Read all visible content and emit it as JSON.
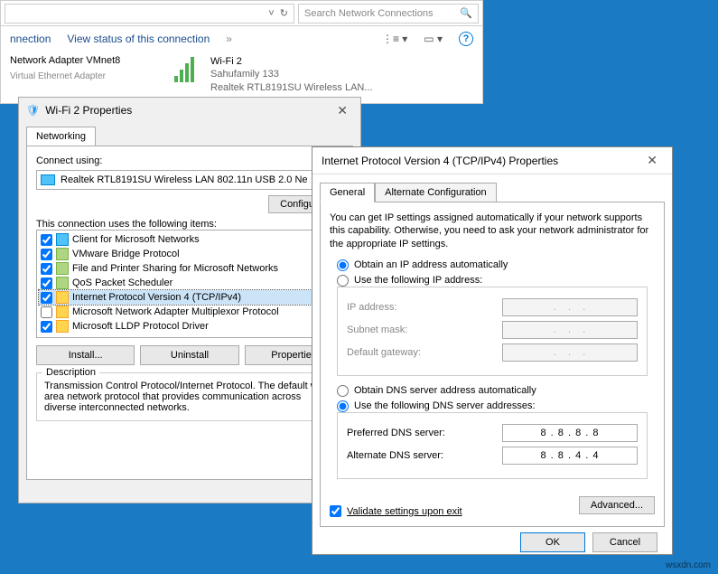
{
  "explorer": {
    "search_placeholder": "Search Network Connections",
    "menu_connection": "nnection",
    "menu_viewstatus": "View status of this connection",
    "sidebar_adapter": "Network Adapter VMnet8",
    "sidebar_virtual": "Virtual Ethernet Adapter",
    "wifi_name": "Wi-Fi 2",
    "wifi_ssid": "Sahufamily  133",
    "wifi_device": "Realtek RTL8191SU Wireless LAN..."
  },
  "props": {
    "title": "Wi-Fi 2 Properties",
    "tab_networking": "Networking",
    "connect_using": "Connect using:",
    "adapter": "Realtek RTL8191SU Wireless LAN 802.11n USB 2.0 Ne",
    "configure_btn": "Configure...",
    "items_label": "This connection uses the following items:",
    "items": [
      {
        "checked": true,
        "label": "Client for Microsoft Networks",
        "icon": "blue"
      },
      {
        "checked": true,
        "label": "VMware Bridge Protocol",
        "icon": "green"
      },
      {
        "checked": true,
        "label": "File and Printer Sharing for Microsoft Networks",
        "icon": "green"
      },
      {
        "checked": true,
        "label": "QoS Packet Scheduler",
        "icon": "green"
      },
      {
        "checked": true,
        "label": "Internet Protocol Version 4 (TCP/IPv4)",
        "icon": "yellow",
        "selected": true
      },
      {
        "checked": false,
        "label": "Microsoft Network Adapter Multiplexor Protocol",
        "icon": "yellow"
      },
      {
        "checked": true,
        "label": "Microsoft LLDP Protocol Driver",
        "icon": "yellow"
      }
    ],
    "install_btn": "Install...",
    "uninstall_btn": "Uninstall",
    "properties_btn": "Properties",
    "desc_label": "Description",
    "desc_text": "Transmission Control Protocol/Internet Protocol. The default wide area network protocol that provides communication across diverse interconnected networks."
  },
  "ipv4": {
    "title": "Internet Protocol Version 4 (TCP/IPv4) Properties",
    "tab_general": "General",
    "tab_alt": "Alternate Configuration",
    "info": "You can get IP settings assigned automatically if your network supports this capability. Otherwise, you need to ask your network administrator for the appropriate IP settings.",
    "radio_auto_ip": "Obtain an IP address automatically",
    "radio_manual_ip": "Use the following IP address:",
    "lbl_ip": "IP address:",
    "lbl_subnet": "Subnet mask:",
    "lbl_gateway": "Default gateway:",
    "radio_auto_dns": "Obtain DNS server address automatically",
    "radio_manual_dns": "Use the following DNS server addresses:",
    "lbl_pref_dns": "Preferred DNS server:",
    "lbl_alt_dns": "Alternate DNS server:",
    "pref_dns": "8 . 8 . 8 . 8",
    "alt_dns": "8 . 8 . 4 . 4",
    "validate": "Validate settings upon exit",
    "advanced_btn": "Advanced...",
    "ok_btn": "OK",
    "cancel_btn": "Cancel"
  },
  "watermark": "wsxdn.com"
}
